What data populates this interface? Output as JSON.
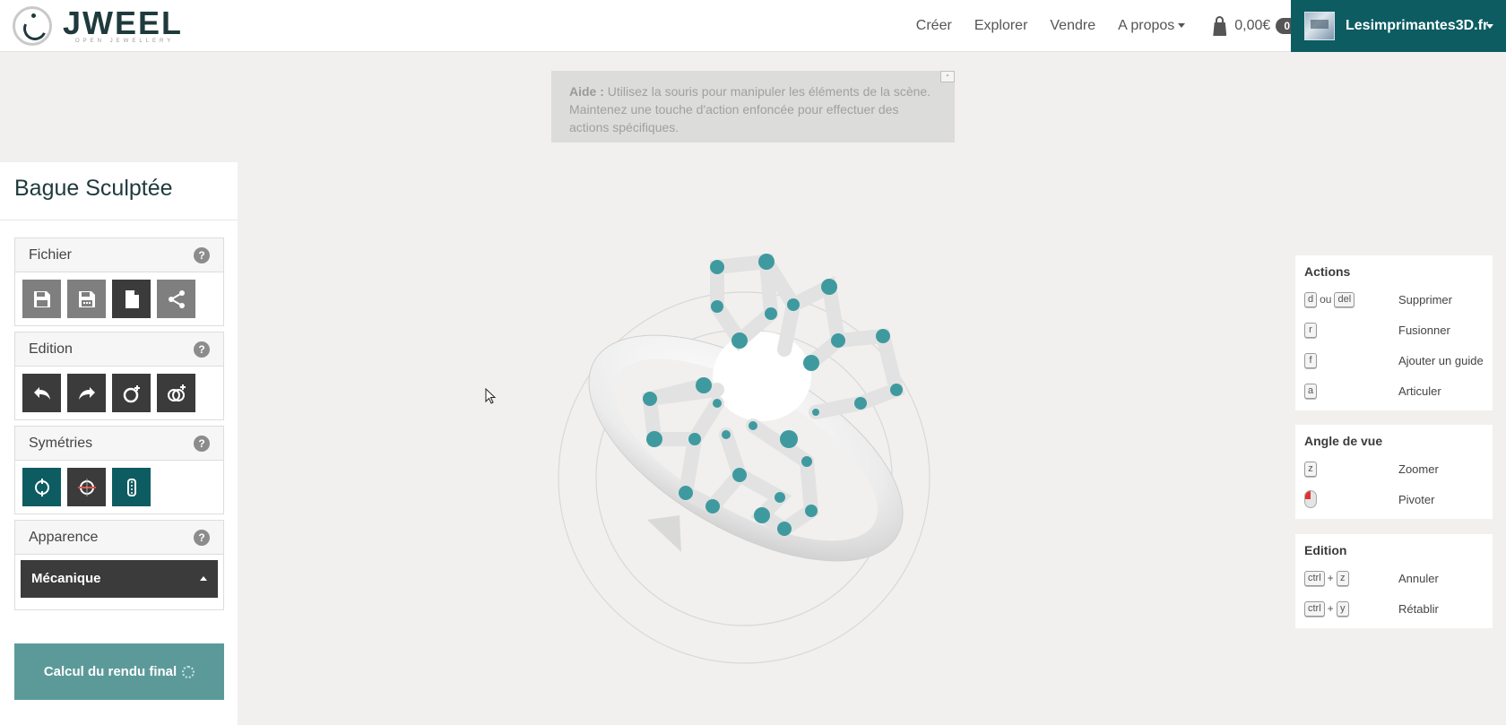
{
  "brand": {
    "name": "JWEEL",
    "tagline": "OPEN JEWELLERY"
  },
  "nav": {
    "links": [
      "Créer",
      "Explorer",
      "Vendre",
      "A propos"
    ],
    "cart_amount": "0,00€",
    "cart_count": "0",
    "user_name": "Lesimprimantes3D.fr"
  },
  "help": {
    "label": "Aide :",
    "text": "Utilisez la souris pour manipuler les éléments de la scène. Maintenez une touche d'action enfoncée pour effectuer des actions spécifiques.",
    "close": "-"
  },
  "left_panel": {
    "title": "Bague Sculptée",
    "sections": {
      "file": "Fichier",
      "edit": "Edition",
      "sym": "Symétries",
      "appearance": "Apparence"
    },
    "help_glyph": "?",
    "appearance_value": "Mécanique",
    "render_button": "Calcul du rendu final"
  },
  "shortcuts": {
    "actions": {
      "title": "Actions",
      "ou": "ou",
      "rows": [
        {
          "keys": [
            "d",
            "del"
          ],
          "label": "Supprimer"
        },
        {
          "keys": [
            "r"
          ],
          "label": "Fusionner"
        },
        {
          "keys": [
            "f"
          ],
          "label": "Ajouter un guide"
        },
        {
          "keys": [
            "a"
          ],
          "label": "Articuler"
        }
      ]
    },
    "view": {
      "title": "Angle de vue",
      "rows": [
        {
          "keys": [
            "z"
          ],
          "label": "Zoomer"
        },
        {
          "keys": [],
          "label": "Pivoter"
        }
      ]
    },
    "edition": {
      "title": "Edition",
      "plus": "+",
      "rows": [
        {
          "keys": [
            "ctrl",
            "z"
          ],
          "label": "Annuler"
        },
        {
          "keys": [
            "ctrl",
            "y"
          ],
          "label": "Rétablir"
        }
      ]
    }
  },
  "colors": {
    "accent": "#0c5c62",
    "render_button": "#5c9a9a",
    "joint": "#3f9aa0"
  }
}
